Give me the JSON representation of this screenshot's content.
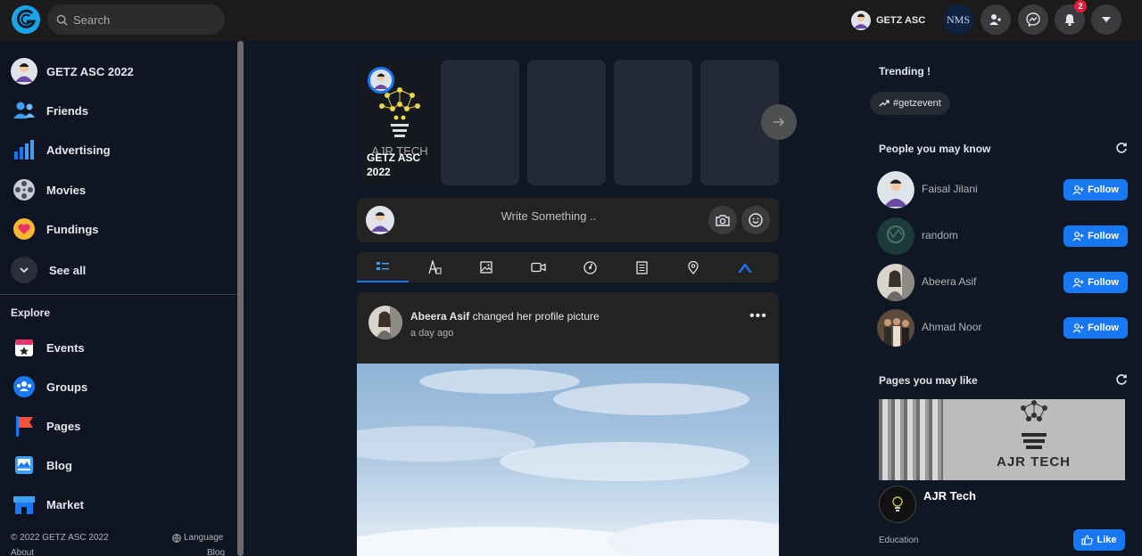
{
  "header": {
    "search_placeholder": "Search",
    "username": "GETZ ASC",
    "monogram": "NMS",
    "notification_count": "2"
  },
  "sidebar": {
    "profile_name": "GETZ ASC 2022",
    "items": [
      {
        "label": "Friends",
        "icon": "friends-icon"
      },
      {
        "label": "Advertising",
        "icon": "advertising-icon"
      },
      {
        "label": "Movies",
        "icon": "movies-icon"
      },
      {
        "label": "Fundings",
        "icon": "fundings-icon"
      }
    ],
    "see_all": "See all",
    "explore_title": "Explore",
    "explore_items": [
      {
        "label": "Events",
        "icon": "events-icon"
      },
      {
        "label": "Groups",
        "icon": "groups-icon"
      },
      {
        "label": "Pages",
        "icon": "pages-icon"
      },
      {
        "label": "Blog",
        "icon": "blog-icon"
      },
      {
        "label": "Market",
        "icon": "market-icon"
      }
    ],
    "footer": {
      "copyright": "© 2022 GETZ ASC 2022",
      "language": "Language",
      "about": "About",
      "blog": "Blog"
    }
  },
  "stories": {
    "first_name": "GETZ ASC 2022",
    "first_logo_text": "AJR TECH"
  },
  "composer": {
    "placeholder": "Write Something .."
  },
  "post": {
    "author": "Abeera Asif",
    "action": "changed her profile picture",
    "time": "a day ago"
  },
  "right": {
    "trending_title": "Trending !",
    "trending_tag": "#getzevent",
    "people_title": "People you may know",
    "follow_label": "Follow",
    "people": [
      {
        "name": "Faisal Jilani"
      },
      {
        "name": "random"
      },
      {
        "name": "Abeera Asif"
      },
      {
        "name": "Ahmad Noor"
      }
    ],
    "pages_title": "Pages you may like",
    "page": {
      "name": "AJR Tech",
      "cover_text": "AJR TECH",
      "category": "Education",
      "like_label": "Like"
    }
  },
  "colors": {
    "accent": "#1877f2",
    "background": "#0f1624",
    "card": "#232323"
  }
}
